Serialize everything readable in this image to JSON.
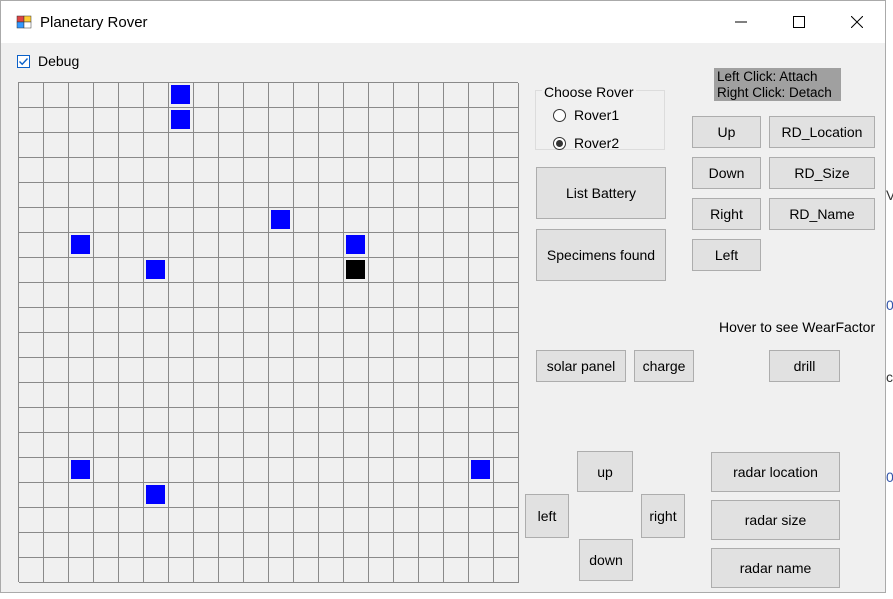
{
  "window": {
    "title": "Planetary Rover"
  },
  "debug": {
    "label": "Debug",
    "checked": true
  },
  "grid": {
    "columns": 20,
    "rows": 20,
    "markers": [
      {
        "col": 6,
        "row": 0,
        "color": "blue"
      },
      {
        "col": 6,
        "row": 1,
        "color": "blue"
      },
      {
        "col": 10,
        "row": 5,
        "color": "blue"
      },
      {
        "col": 2,
        "row": 6,
        "color": "blue"
      },
      {
        "col": 13,
        "row": 6,
        "color": "blue"
      },
      {
        "col": 5,
        "row": 7,
        "color": "blue"
      },
      {
        "col": 13,
        "row": 7,
        "color": "black"
      },
      {
        "col": 2,
        "row": 15,
        "color": "blue"
      },
      {
        "col": 18,
        "row": 15,
        "color": "blue"
      },
      {
        "col": 5,
        "row": 16,
        "color": "blue"
      }
    ],
    "colors": {
      "blue": "#0000ff",
      "black": "#000000",
      "line": "#8a8a8a"
    }
  },
  "choose_rover": {
    "title": "Choose Rover",
    "options": [
      {
        "label": "Rover1",
        "checked": false
      },
      {
        "label": "Rover2",
        "checked": true
      }
    ]
  },
  "buttons": {
    "list_battery": "List Battery",
    "specimens_found": "Specimens found",
    "up": "Up",
    "down": "Down",
    "right": "Right",
    "left": "Left",
    "rd_location": "RD_Location",
    "rd_size": "RD_Size",
    "rd_name": "RD_Name",
    "solar_panel": "solar panel",
    "charge": "charge",
    "drill": "drill",
    "pad_up": "up",
    "pad_left": "left",
    "pad_right": "right",
    "pad_down": "down",
    "radar_location": "radar location",
    "radar_size": "radar size",
    "radar_name": "radar name"
  },
  "hint": {
    "line1": "Left Click: Attach",
    "line2": "Right Click: Detach"
  },
  "hover_label": "Hover to see WearFactor",
  "background_edge_text": {
    "a": "V",
    "b": "0",
    "c": "c",
    "d": "0"
  }
}
